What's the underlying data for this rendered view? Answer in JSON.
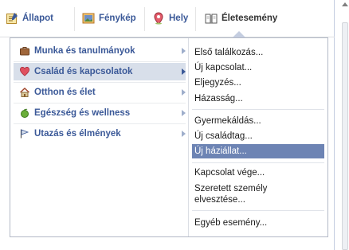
{
  "tabs": [
    {
      "label": "Állapot",
      "icon": "status-icon"
    },
    {
      "label": "Fénykép",
      "icon": "photo-icon"
    },
    {
      "label": "Hely",
      "icon": "location-pin-icon"
    },
    {
      "label": "Életesemény",
      "icon": "life-event-book-icon",
      "active": true
    }
  ],
  "categories": [
    {
      "label": "Munka és tanulmányok",
      "icon": "briefcase-icon"
    },
    {
      "label": "Család és kapcsolatok",
      "icon": "heart-icon",
      "selected": true
    },
    {
      "label": "Otthon és élet",
      "icon": "house-icon"
    },
    {
      "label": "Egészség és wellness",
      "icon": "apple-icon"
    },
    {
      "label": "Utazás és élmények",
      "icon": "flag-icon"
    }
  ],
  "subitems": [
    "Első találkozás...",
    "Új kapcsolat...",
    "Eljegyzés...",
    "Házasság...",
    "Gyermekáldás...",
    "Új családtag...",
    "Új háziállat...",
    "Kapcsolat vége...",
    "Szeretett személy elvesztése...",
    "Egyéb esemény..."
  ],
  "colors": {
    "link": "#3b5998",
    "hover": "#6d84b4",
    "selected_bg": "#d8dfea"
  }
}
